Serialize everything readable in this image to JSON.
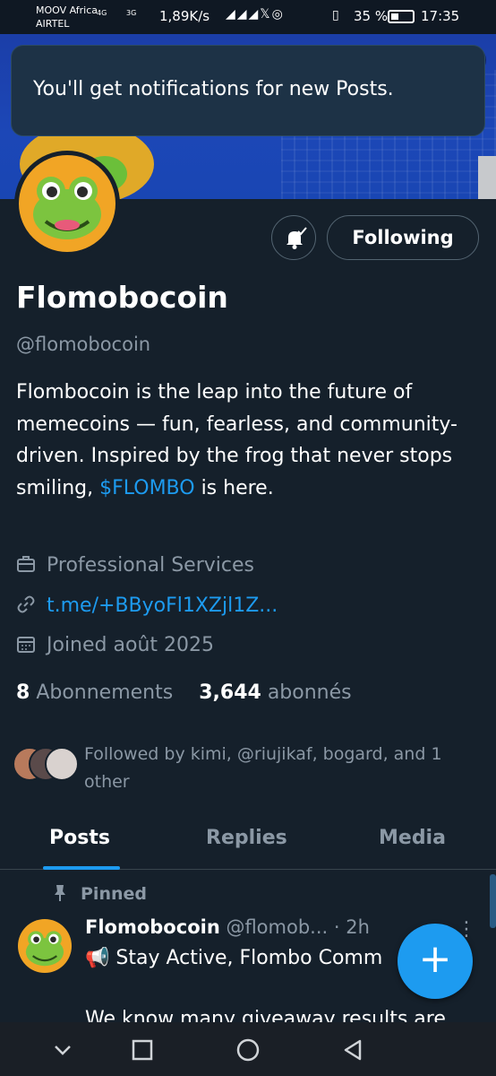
{
  "status_bar": {
    "carrier1": "MOOV Africa",
    "carrier2": "AIRTEL",
    "net1": "4G",
    "net2": "3G",
    "speed": "1,89K/s",
    "notif_icons": "◢◢◢𝕏◎",
    "battery": "35 %",
    "time": "17:35"
  },
  "toast": {
    "message": "You'll get notifications for new Posts."
  },
  "profile": {
    "follow_label": "Following",
    "name": "Flomobocoin",
    "handle": "@flomobocoin",
    "bio_before": "Flombocoin is the leap into the future of memecoins — fun, fearless, and community-driven. Inspired by the frog that never stops smiling, ",
    "bio_cashtag": "$FLOMBO",
    "bio_after": " is here.",
    "category": "Professional Services",
    "link": "t.me/+BByoFl1XZjl1Z...",
    "joined": "Joined août 2025",
    "following_count": "8",
    "following_label": "Abonnements",
    "followers_count": "3,644",
    "followers_label": "abonnés",
    "followed_by": "Followed by kimi, @riujikaf, bogard, and 1 other"
  },
  "tabs": [
    {
      "label": "Posts"
    },
    {
      "label": "Replies"
    },
    {
      "label": "Media"
    }
  ],
  "post": {
    "pinned_label": "Pinned",
    "author": "Flomobocoin",
    "handle_time": "@flomob... · 2h",
    "more": "⋮",
    "line1": "📢 Stay Active, Flombo Comm",
    "line2": "We know many giveaway results are"
  },
  "fab": {
    "label": "+"
  },
  "colors": {
    "accent": "#1d9bf0",
    "background": "#15202b",
    "muted": "#8b98a5"
  },
  "icons": [
    "bell-check-icon",
    "briefcase-icon",
    "link-icon",
    "calendar-icon",
    "pin-icon",
    "plus-icon",
    "back-chevron-icon",
    "square-icon",
    "circle-icon",
    "triangle-icon"
  ]
}
